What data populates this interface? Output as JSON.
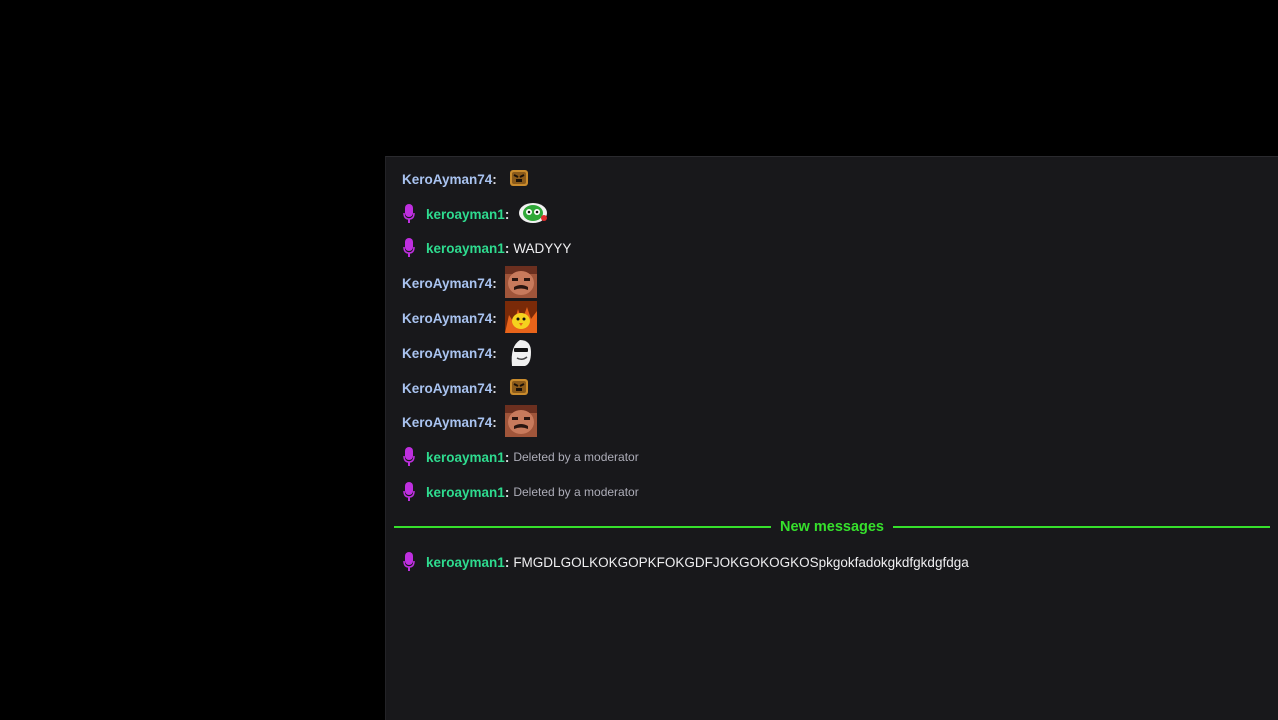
{
  "chat": {
    "messages": [
      {
        "user": "KeroAyman74",
        "sep": ":",
        "emote": "bear-emote"
      },
      {
        "user": "keroayman1",
        "sep": ":",
        "emote": "green-blob-emote",
        "badge": "microphone-icon"
      },
      {
        "user": "keroayman1",
        "sep": ":",
        "text": "WADYYY",
        "badge": "microphone-icon"
      },
      {
        "user": "KeroAyman74",
        "sep": ":",
        "emote": "face-emote"
      },
      {
        "user": "KeroAyman74",
        "sep": ":",
        "emote": "fire-chicken-emote"
      },
      {
        "user": "KeroAyman74",
        "sep": ":",
        "emote": "white-ghost-emote"
      },
      {
        "user": "KeroAyman74",
        "sep": ":",
        "emote": "bear-emote"
      },
      {
        "user": "KeroAyman74",
        "sep": ":",
        "emote": "face-emote"
      },
      {
        "user": "keroayman1",
        "sep": ":",
        "deleted": "Deleted by a moderator",
        "badge": "microphone-icon"
      },
      {
        "user": "keroayman1",
        "sep": ":",
        "deleted": "Deleted by a moderator",
        "badge": "microphone-icon"
      }
    ],
    "divider_label": "New messages",
    "new_message": {
      "user": "keroayman1",
      "sep": ":",
      "text": "FMGDLGOLKOKGOPKFOKGDFJOKGOKOGKOSpkgokfadokgkdfgkdgfdga",
      "badge": "microphone-icon"
    }
  },
  "colors": {
    "user_a": "#a9c3f0",
    "user_b": "#2edb8f",
    "badge": "#bf2fe0",
    "new_messages": "#36e02c",
    "panel_bg": "#18181b"
  }
}
